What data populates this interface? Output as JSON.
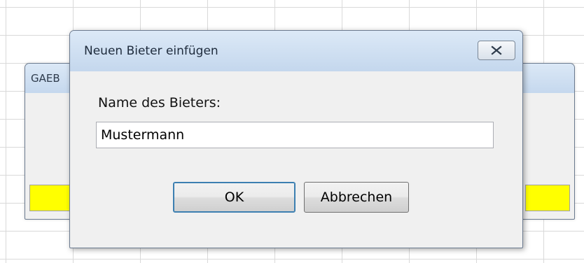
{
  "background_window": {
    "title": "GAEB",
    "highlight_color": "#ffff00"
  },
  "dialog": {
    "title": "Neuen Bieter einfügen",
    "close_icon": "close-icon",
    "label": "Name des Bieters:",
    "name_input": {
      "value": "Mustermann"
    },
    "ok_label": "OK",
    "cancel_label": "Abbrechen"
  }
}
